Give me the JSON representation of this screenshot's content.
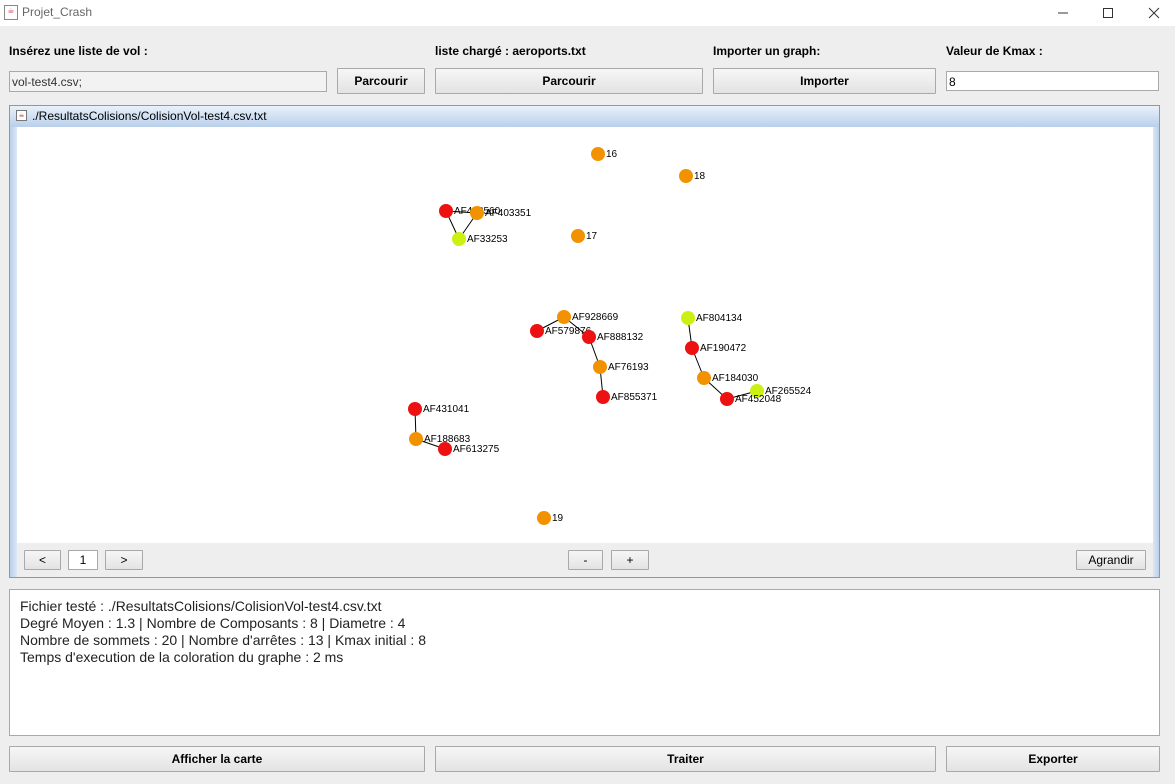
{
  "window": {
    "title": "Projet_Crash"
  },
  "top": {
    "vol_label": "Insérez une liste de vol :",
    "vol_value": "vol-test4.csv;",
    "vol_browse": "Parcourir",
    "airports_label": "liste chargé : aeroports.txt",
    "airports_browse": "Parcourir",
    "import_label": "Importer un graph:",
    "import_button": "Importer",
    "kmax_label": "Valeur de Kmax :",
    "kmax_value": "8"
  },
  "frame": {
    "title": "./ResultatsColisions/ColisionVol-test4.csv.txt"
  },
  "graph": {
    "colors": {
      "red": "#ee1111",
      "orange": "#f39200",
      "lime": "#ccf012",
      "edge": "#000000"
    },
    "nodes": [
      {
        "id": "16",
        "color": "orange"
      },
      {
        "id": "18",
        "color": "orange"
      },
      {
        "id": "AF418560",
        "color": "red"
      },
      {
        "id": "AF403351",
        "color": "orange"
      },
      {
        "id": "AF33253",
        "color": "lime"
      },
      {
        "id": "17",
        "color": "orange"
      },
      {
        "id": "AF928669",
        "color": "orange"
      },
      {
        "id": "AF579876",
        "color": "red"
      },
      {
        "id": "AF888132",
        "color": "red"
      },
      {
        "id": "AF76193",
        "color": "orange"
      },
      {
        "id": "AF855371",
        "color": "red"
      },
      {
        "id": "AF804134",
        "color": "lime"
      },
      {
        "id": "AF190472",
        "color": "red"
      },
      {
        "id": "AF184030",
        "color": "orange"
      },
      {
        "id": "AF265524",
        "color": "lime"
      },
      {
        "id": "AF452048",
        "color": "red"
      },
      {
        "id": "AF431041",
        "color": "red"
      },
      {
        "id": "AF188683",
        "color": "orange"
      },
      {
        "id": "AF613275",
        "color": "red"
      },
      {
        "id": "19",
        "color": "orange"
      }
    ],
    "edges": [
      [
        "AF418560",
        "AF403351"
      ],
      [
        "AF418560",
        "AF33253"
      ],
      [
        "AF403351",
        "AF33253"
      ],
      [
        "AF579876",
        "AF928669"
      ],
      [
        "AF928669",
        "AF888132"
      ],
      [
        "AF888132",
        "AF76193"
      ],
      [
        "AF76193",
        "AF855371"
      ],
      [
        "AF804134",
        "AF190472"
      ],
      [
        "AF190472",
        "AF184030"
      ],
      [
        "AF184030",
        "AF452048"
      ],
      [
        "AF452048",
        "AF265524"
      ],
      [
        "AF431041",
        "AF188683"
      ],
      [
        "AF188683",
        "AF613275"
      ]
    ]
  },
  "toolbar": {
    "prev": "<",
    "page": "1",
    "next": ">",
    "zoom_out": "-",
    "zoom_in": "+",
    "enlarge": "Agrandir"
  },
  "info": {
    "line1": "Fichier testé : ./ResultatsColisions/ColisionVol-test4.csv.txt",
    "line2": "Degré Moyen : 1.3 | Nombre de Composants : 8 | Diametre : 4",
    "line3": "Nombre de sommets : 20 | Nombre d'arrêtes : 13 | Kmax initial : 8",
    "line4": "Temps d'execution de la coloration du graphe : 2 ms"
  },
  "bottom": {
    "map_button": "Afficher la carte",
    "process_button": "Traiter",
    "export_button": "Exporter"
  }
}
